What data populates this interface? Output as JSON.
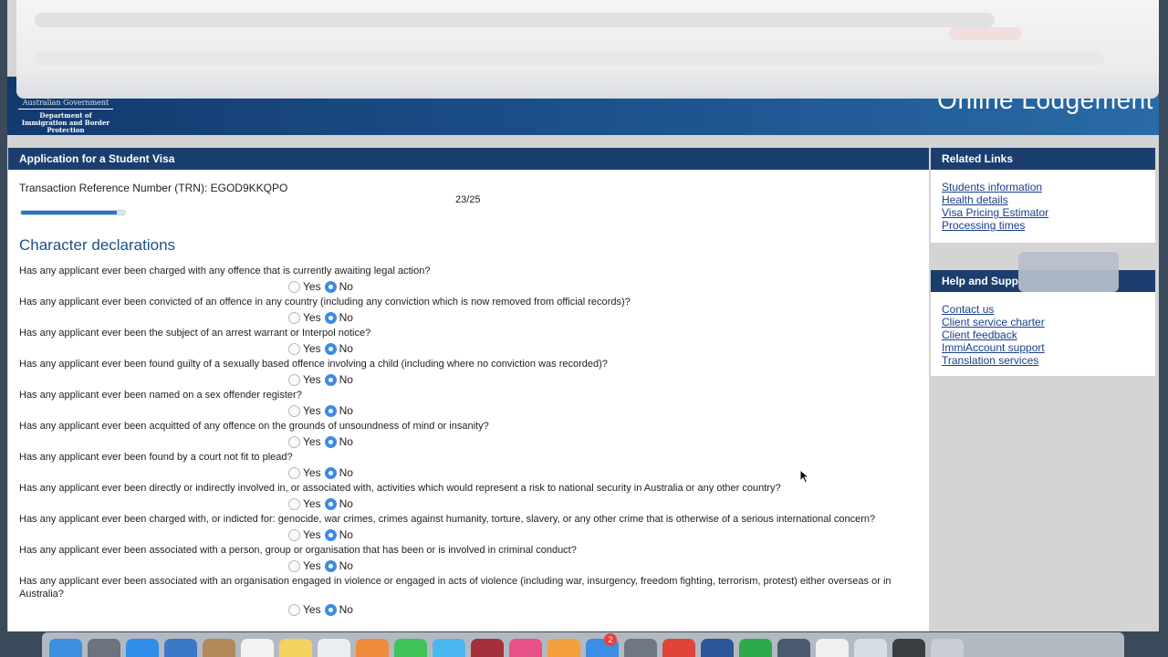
{
  "header": {
    "gov_line": "Australian Government",
    "department": "Department of Immigration and Border Protection",
    "title": "Online Lodgement"
  },
  "application": {
    "panel_title": "Application for a Student Visa",
    "trn": "Transaction Reference Number (TRN): EGOD9KKQPO",
    "page_count": "23/25",
    "progress": 0.92,
    "section_title": "Character declarations",
    "yes_label": "Yes",
    "no_label": "No",
    "questions": [
      {
        "text": "Has any applicant ever been charged with any offence that is currently awaiting legal action?",
        "answer": "No"
      },
      {
        "text": "Has any applicant ever been convicted of an offence in any country (including any conviction which is now removed from official records)?",
        "answer": "No"
      },
      {
        "text": "Has any applicant ever been the subject of an arrest warrant or Interpol notice?",
        "answer": "No"
      },
      {
        "text": "Has any applicant ever been found guilty of a sexually based offence involving a child (including where no conviction was recorded)?",
        "answer": "No"
      },
      {
        "text": "Has any applicant ever been named on a sex offender register?",
        "answer": "No"
      },
      {
        "text": "Has any applicant ever been acquitted of any offence on the grounds of unsoundness of mind or insanity?",
        "answer": "No"
      },
      {
        "text": "Has any applicant ever been found by a court not fit to plead?",
        "answer": "No"
      },
      {
        "text": "Has any applicant ever been directly or indirectly involved in, or associated with, activities which would represent a risk to national security in Australia or any other country?",
        "answer": "No"
      },
      {
        "text": "Has any applicant ever been charged with, or indicted for: genocide, war crimes, crimes against humanity, torture, slavery, or any other crime that is otherwise of a serious international concern?",
        "answer": "No"
      },
      {
        "text": "Has any applicant ever been associated with a person, group or organisation that has been or is involved in criminal conduct?",
        "answer": "No"
      },
      {
        "text": "Has any applicant ever been associated with an organisation engaged in violence or engaged in acts of violence (including war, insurgency, freedom fighting, terrorism, protest) either overseas or in Australia?",
        "answer": "No"
      }
    ]
  },
  "related_links": {
    "title": "Related Links",
    "items": [
      "Students information",
      "Health details",
      "Visa Pricing Estimator",
      "Processing times"
    ]
  },
  "help": {
    "title": "Help and Supp",
    "items": [
      "Contact us",
      "Client service charter",
      "Client feedback",
      "ImmiAccount support",
      "Translation services"
    ]
  },
  "dock": {
    "badge_count": "2",
    "icons": [
      {
        "name": "finder-icon",
        "color": "#3d8fe0"
      },
      {
        "name": "launchpad-icon",
        "color": "#6b7380"
      },
      {
        "name": "safari-icon",
        "color": "#2f8ee8"
      },
      {
        "name": "mail-icon",
        "color": "#3b78c8"
      },
      {
        "name": "contacts-icon",
        "color": "#b08a5a"
      },
      {
        "name": "calendar-icon",
        "color": "#f2f2f2"
      },
      {
        "name": "notes-icon",
        "color": "#f3d25e"
      },
      {
        "name": "reminders-icon",
        "color": "#e9eef3"
      },
      {
        "name": "photos-icon",
        "color": "#f08a3c"
      },
      {
        "name": "facetime-icon",
        "color": "#3ec25a"
      },
      {
        "name": "messages-icon",
        "color": "#49b8f0"
      },
      {
        "name": "photobooth-icon",
        "color": "#a6303a"
      },
      {
        "name": "itunes-icon",
        "color": "#e8508a"
      },
      {
        "name": "ibooks-icon",
        "color": "#f2a13a"
      },
      {
        "name": "appstore-icon",
        "color": "#3a8ee6"
      },
      {
        "name": "system-preferences-icon",
        "color": "#707780"
      },
      {
        "name": "chrome-icon",
        "color": "#e04438"
      },
      {
        "name": "word-icon",
        "color": "#2b579a"
      },
      {
        "name": "evernote-icon",
        "color": "#2eaa4a"
      },
      {
        "name": "quicktime-icon",
        "color": "#4a5a70"
      },
      {
        "name": "document-icon",
        "color": "#eef0f2"
      },
      {
        "name": "downloads-icon",
        "color": "#d7dde4"
      },
      {
        "name": "terminal-icon",
        "color": "#3a3d42"
      },
      {
        "name": "trash-icon",
        "color": "#c9ced4"
      }
    ]
  }
}
